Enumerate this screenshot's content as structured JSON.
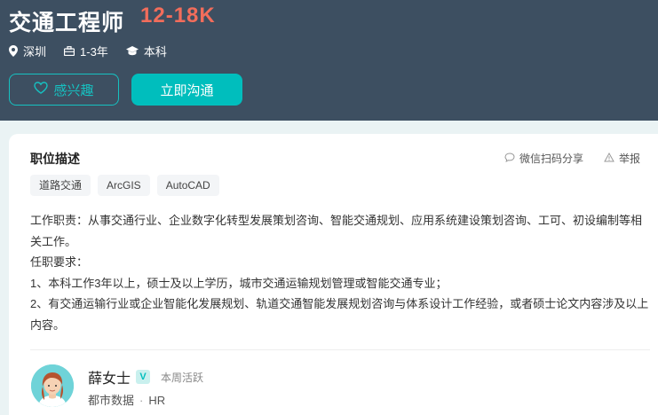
{
  "job": {
    "title": "交通工程师",
    "salary": "12-18K",
    "location": "深圳",
    "experience": "1-3年",
    "degree": "本科"
  },
  "buttons": {
    "interest": "感兴趣",
    "chat": "立即沟通"
  },
  "section": {
    "title": "职位描述",
    "share": "微信扫码分享",
    "report": "举报"
  },
  "tags": [
    "道路交通",
    "ArcGIS",
    "AutoCAD"
  ],
  "description": [
    "工作职责：从事交通行业、企业数字化转型发展策划咨询、智能交通规划、应用系统建设策划咨询、工可、初设编制等相关工作。",
    "任职要求：",
    "1、本科工作3年以上，硕士及以上学历，城市交通运输规划管理或智能交通专业；",
    "2、有交通运输行业或企业智能化发展规划、轨道交通智能发展规划咨询与体系设计工作经验，或者硕士论文内容涉及以上内容。"
  ],
  "recruiter": {
    "name": "薛女士",
    "verified_badge": "V",
    "status": "本周活跃",
    "company": "都市数据",
    "separator": "·",
    "role": "HR"
  },
  "colors": {
    "header_bg": "#3d4f61",
    "accent": "#00bebd",
    "salary": "#f26d5b"
  }
}
